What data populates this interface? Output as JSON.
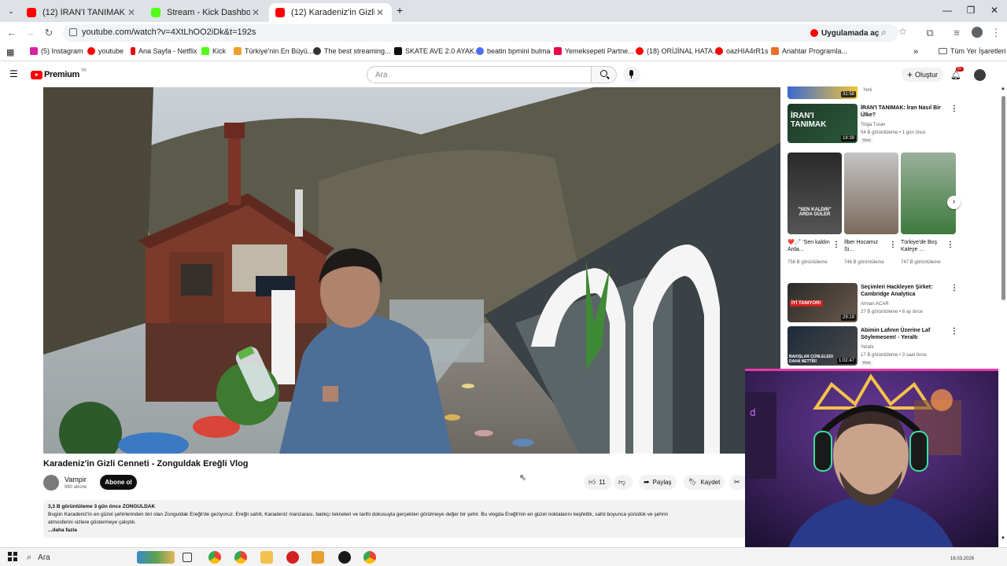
{
  "browser": {
    "tabs": [
      {
        "title": "(12) İRAN'I TANIMAK: İran Nasıl",
        "color": "#ff0000",
        "active": false
      },
      {
        "title": "Stream - Kick Dashboard",
        "color": "#53fc18",
        "active": false
      },
      {
        "title": "(12) Karadeniz'in Gizli Cenneti",
        "color": "#ff0000",
        "active": true
      }
    ],
    "new_tab": "+",
    "url": "youtube.com/watch?v=4XtLhOO2iDk&t=192s",
    "open_in_app": "Uygulamada aç",
    "all_bookmarks": "Tüm Yer İşaretleri",
    "bookmarks": [
      {
        "label": "(5) Instagram",
        "color": "#d6249f"
      },
      {
        "label": "youtube",
        "color": "#ff0000"
      },
      {
        "label": "Ana Sayfa - Netflix",
        "color": "#e50914"
      },
      {
        "label": "Kick",
        "color": "#53fc18"
      },
      {
        "label": "Türkiye'nin En Büyü...",
        "color": "#f0a030"
      },
      {
        "label": "The best streaming...",
        "color": "#333333"
      },
      {
        "label": "SKATE AVE 2.0 AYAK...",
        "color": "#111111"
      },
      {
        "label": "beatin bpmini bulma",
        "color": "#4a6cf7"
      },
      {
        "label": "Yemeksepeti Partne...",
        "color": "#ea004b"
      },
      {
        "label": "(18) ORİJİNAL HATA...",
        "color": "#ff0000"
      },
      {
        "label": "oazHIA4rR1s",
        "color": "#ff0000"
      },
      {
        "label": "Anahtar Programla...",
        "color": "#e8702a"
      }
    ]
  },
  "youtube": {
    "logo_text": "Premium",
    "logo_sup": "TR",
    "search_placeholder": "Ara",
    "create_label": "Oluştur",
    "notif_count": "9+",
    "video_title": "Karadeniz'in Gizli Cenneti - Zonguldak Ereğli Vlog",
    "channel_name": "Vampir",
    "channel_subs": "980 abone",
    "subscribe_label": "Abone ol",
    "like_count": "11",
    "share_label": "Paylaş",
    "save_label": "Kaydet",
    "desc_meta": "3,3 B görüntüleme  3 gün önce  ZONGULDAK",
    "desc_line1": "Bugün Karadeniz'in en güzel şehirlerinden biri olan Zonguldak Ereğli'de geziyoruz. Ereğli sahili, Karadeniz manzarası, balıkçı tekneleri ve tarihi dokusuyla gerçekten görülmeye değer bir şehir. Bu vlogda Ereğli'nin en güzel noktalarını keşfettik, sahil boyunca yürüdük ve şehrin",
    "desc_line2": "atmosferini sizlere göstermeye çalıştık.",
    "desc_more": "...daha fazla"
  },
  "sidebar": {
    "top_new": "Yeni",
    "items": [
      {
        "title": "İRAN'I TANIMAK: İran Nasıl Bir Ülke?",
        "channel": "Tolga Turan",
        "meta": "54 B görüntüleme • 1 gün önce",
        "badge": "Yeni",
        "duration": "18:39"
      },
      {
        "title": "Seçimleri Hackleyen Şirket: Cambridge Analytica",
        "channel": "Arman ACAR",
        "meta": "27 B görüntüleme • 6 ay önce",
        "duration": "29:19"
      },
      {
        "title": "Abimin Lafının Üzerine Laf Söylemesem! - Yeraltı",
        "channel": "Yeraltı",
        "meta": "17 B görüntüleme • 3 saat önce",
        "badge": "Yeni",
        "duration": "1:02:47"
      }
    ],
    "top_duration": "31:58",
    "shorts": [
      {
        "title": "❤️🧷 'Sen kaldın Arda...",
        "views": "758 B görüntüleme",
        "thumb_text": "\"SEN KALDIN\" ARDA GÜLER"
      },
      {
        "title": "İlber Hocamız Si...",
        "views": "746 B görüntüleme",
        "thumb_text": ""
      },
      {
        "title": "Türkiye'de Boş Kaleye ...",
        "views": "747 B görüntüleme",
        "thumb_text": ""
      }
    ],
    "thumb1_text": "İRAN'I TANIMAK",
    "thumb2_text": "İYİ TANIYOR!",
    "thumb3_text": "BAKIŞLAR ÇÜNLELEDI DAHA NETTIR!"
  },
  "taskbar": {
    "search_label": "Ara",
    "date": "16.03.2026"
  }
}
